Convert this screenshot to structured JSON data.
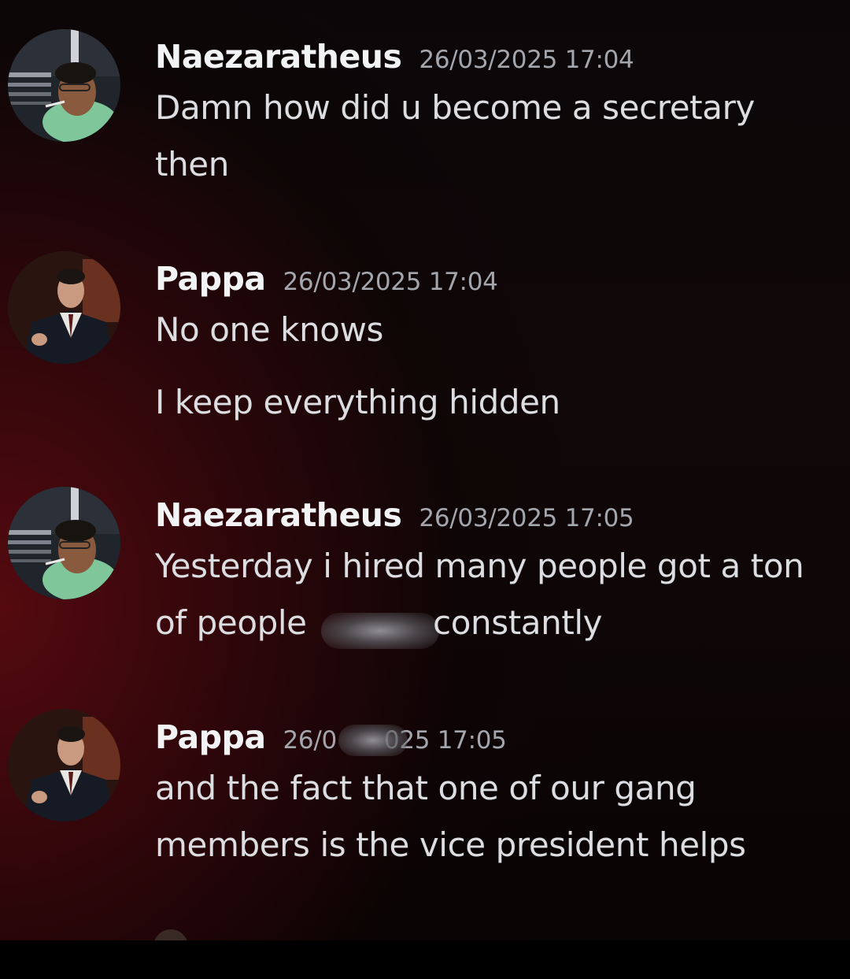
{
  "messages": [
    {
      "username": "Naezaratheus",
      "timestamp": "26/03/2025 17:04",
      "lines": [
        "Damn how did u become a secretary",
        "then"
      ]
    },
    {
      "username": "Pappa",
      "timestamp": "26/03/2025 17:04",
      "lines": [
        "No one knows",
        "I keep everything hidden"
      ]
    },
    {
      "username": "Naezaratheus",
      "timestamp": "26/03/2025 17:05",
      "lines": [
        "Yesterday i hired many people got a ton",
        "of people",
        "constantly"
      ]
    },
    {
      "username": "Pappa",
      "timestamp_start": "26/0",
      "timestamp_end": "025 17:05",
      "lines": [
        "and the fact that one of our gang",
        "members is the vice president helps"
      ]
    }
  ],
  "colors": {
    "username": "#f2f3f5",
    "timestamp": "#a3a6ad",
    "message_text": "#dcdde1",
    "background_glow": "#580a10"
  },
  "avatars": {
    "naezaratheus": "person-smoking-photo-avatar",
    "pappa": "man-in-suit-photo-avatar"
  }
}
